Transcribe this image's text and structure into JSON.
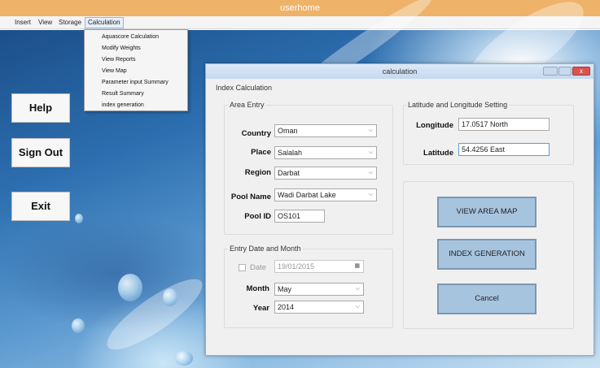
{
  "main_window": {
    "title": "userhome"
  },
  "menubar": {
    "items": [
      "Insert",
      "View",
      "Storage",
      "Calculation"
    ]
  },
  "calculation_menu": {
    "items": [
      "Aquascore Calculation",
      "Modify Weights",
      "View Reports",
      "View Map",
      "Parameter input Summary",
      "Result Summary",
      "index generation"
    ]
  },
  "side_buttons": {
    "help": "Help",
    "sign_out": "Sign Out",
    "exit": "Exit"
  },
  "dialog": {
    "title": "calculation",
    "close_glyph": "x",
    "section_title": "Index Calculation",
    "area_entry": {
      "caption": "Area Entry",
      "country_label": "Country",
      "country_value": "Oman",
      "place_label": "Place",
      "place_value": "Salalah",
      "region_label": "Region",
      "region_value": "Darbat",
      "pool_name_label": "Pool Name",
      "pool_name_value": "Wadi Darbat Lake",
      "pool_id_label": "Pool ID",
      "pool_id_value": "OS101"
    },
    "entry_date": {
      "caption": "Entry Date and Month",
      "date_label": "Date",
      "date_value": "19/01/2015",
      "date_checked": false,
      "month_label": "Month",
      "month_value": "May",
      "year_label": "Year",
      "year_value": "2014"
    },
    "lat_long": {
      "caption": "Latitude and Longitude Setting",
      "longitude_label": "Longitude",
      "longitude_value": "17.0517 North",
      "latitude_label": "Latitude",
      "latitude_value": "54.4256 East"
    },
    "actions": {
      "view_map": "VIEW AREA MAP",
      "index_generation": "INDEX GENERATION",
      "cancel": "Cancel"
    }
  },
  "icons": {
    "dropdown_arrow": "chevron-down-icon",
    "calendar": "calendar-icon",
    "close": "close-icon"
  },
  "colors": {
    "titlebar": "#efb269",
    "action_button": "#a7c4df",
    "close_button": "#d9534f"
  }
}
